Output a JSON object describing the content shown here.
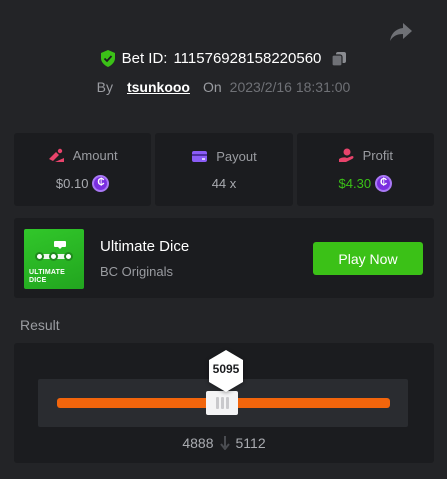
{
  "header": {
    "bet_label": "Bet ID:",
    "bet_id": "111576928158220560",
    "by_label": "By",
    "username": "tsunkooo",
    "on_label": "On",
    "date": "2023/2/16 18:31:00"
  },
  "stats": [
    {
      "label": "Amount",
      "value": "$0.10",
      "icon": "bet-chips-icon",
      "color": "#e8436b"
    },
    {
      "label": "Payout",
      "value": "44 x",
      "icon": "wallet-icon",
      "color": "#8a5cf6"
    },
    {
      "label": "Profit",
      "value": "$4.30",
      "icon": "hand-coins-icon",
      "color": "#e8436b"
    }
  ],
  "coin_symbol": "₵",
  "game": {
    "thumb_text_line1": "ULTIMATE",
    "thumb_text_line2": "DICE",
    "title": "Ultimate Dice",
    "provider": "BC Originals",
    "play_label": "Play Now"
  },
  "result": {
    "label": "Result",
    "roll": "5095",
    "range_low": "4888",
    "range_high": "5112"
  },
  "colors": {
    "accent_green": "#3bc117",
    "track_orange": "#f2650c",
    "card_bg": "#1b1c1f",
    "page_bg": "#232427"
  }
}
